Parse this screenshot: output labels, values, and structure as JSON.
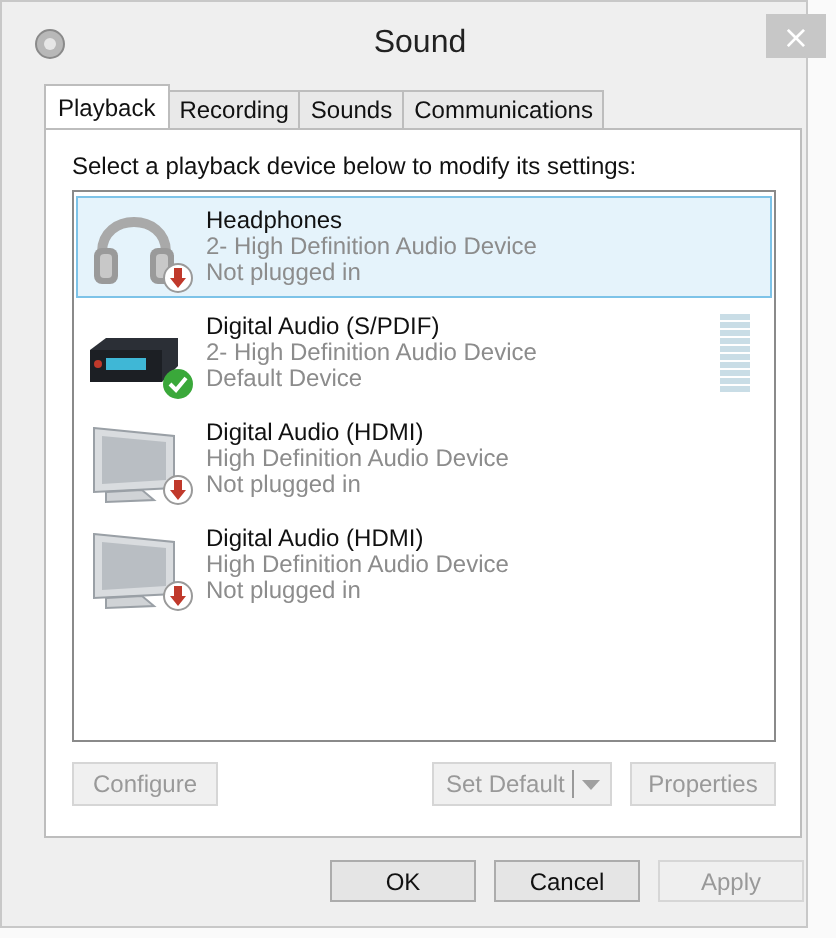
{
  "window": {
    "title": "Sound",
    "close": "×"
  },
  "tabs": [
    {
      "label": "Playback",
      "selected": true
    },
    {
      "label": "Recording",
      "selected": false
    },
    {
      "label": "Sounds",
      "selected": false
    },
    {
      "label": "Communications",
      "selected": false
    }
  ],
  "instruction": "Select a playback device below to modify its settings:",
  "devices": [
    {
      "kind": "headphones",
      "name": "Headphones",
      "driver": "2- High Definition Audio Device",
      "status": "Not plugged in",
      "unplugged": true,
      "default": false,
      "selected": true
    },
    {
      "kind": "receiver",
      "name": "Digital Audio (S/PDIF)",
      "driver": "2- High Definition Audio Device",
      "status": "Default Device",
      "unplugged": false,
      "default": true,
      "selected": false,
      "meter": true
    },
    {
      "kind": "monitor",
      "name": "Digital Audio (HDMI)",
      "driver": "High Definition Audio Device",
      "status": "Not plugged in",
      "unplugged": true,
      "default": false,
      "selected": false
    },
    {
      "kind": "monitor",
      "name": "Digital Audio (HDMI)",
      "driver": "High Definition Audio Device",
      "status": "Not plugged in",
      "unplugged": true,
      "default": false,
      "selected": false
    }
  ],
  "panel_buttons": [
    {
      "kind": "plain",
      "label": "Configure",
      "disabled": true
    },
    {
      "kind": "split",
      "label": "Set Default",
      "disabled": true
    },
    {
      "kind": "plain",
      "label": "Properties",
      "disabled": true
    }
  ],
  "dialog_buttons": [
    {
      "label": "OK",
      "disabled": false
    },
    {
      "label": "Cancel",
      "disabled": false
    },
    {
      "label": "Apply",
      "disabled": true
    }
  ]
}
